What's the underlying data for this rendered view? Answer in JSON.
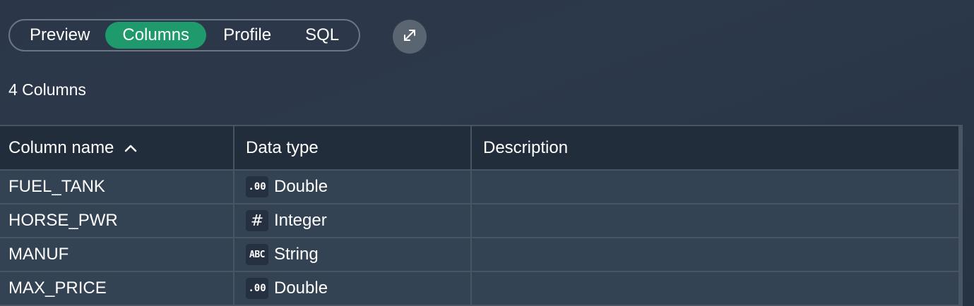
{
  "tabs": [
    {
      "label": "Preview",
      "active": false
    },
    {
      "label": "Columns",
      "active": true
    },
    {
      "label": "Profile",
      "active": false
    },
    {
      "label": "SQL",
      "active": false
    }
  ],
  "column_count_label": "4 Columns",
  "table": {
    "headers": {
      "name": "Column name",
      "type": "Data type",
      "description": "Description"
    },
    "rows": [
      {
        "name": "FUEL_TANK",
        "type_icon": ".00",
        "type": "Double",
        "description": ""
      },
      {
        "name": "HORSE_PWR",
        "type_icon": "#",
        "type": "Integer",
        "description": ""
      },
      {
        "name": "MANUF",
        "type_icon": "ABC",
        "type": "String",
        "description": ""
      },
      {
        "name": "MAX_PRICE",
        "type_icon": ".00",
        "type": "Double",
        "description": ""
      }
    ]
  },
  "icons": {
    "sort": "chevron-up-icon",
    "expand": "expand-arrows-icon"
  },
  "colors": {
    "active_tab": "#1f9a6d",
    "background": "#2c394b",
    "header_bg": "#222d3b",
    "row_bg": "#344354"
  }
}
